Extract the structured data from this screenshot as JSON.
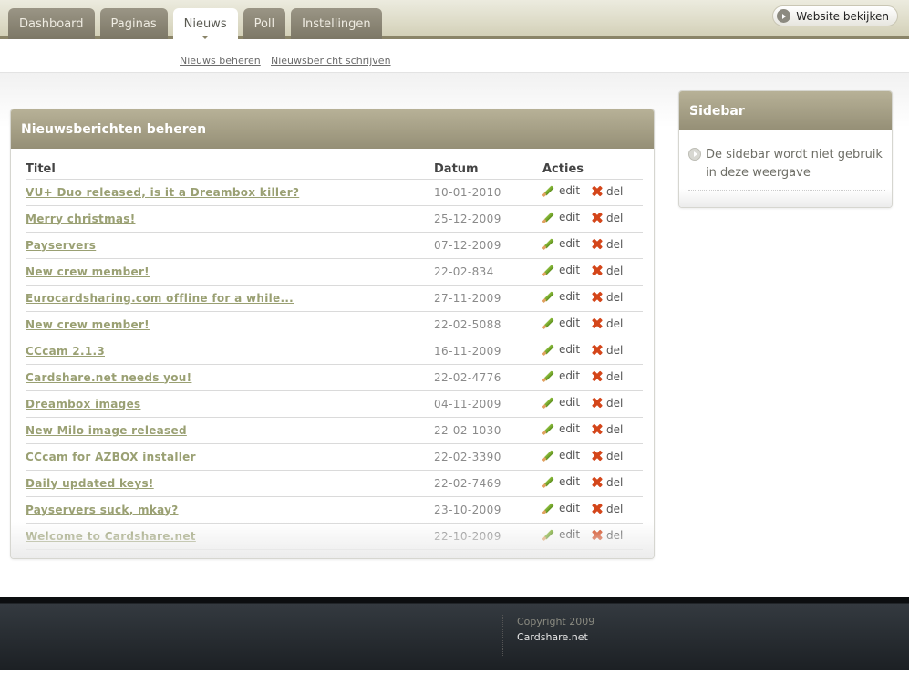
{
  "nav": {
    "tabs": [
      {
        "label": "Dashboard"
      },
      {
        "label": "Paginas"
      },
      {
        "label": "Nieuws",
        "active": true
      },
      {
        "label": "Poll"
      },
      {
        "label": "Instellingen"
      }
    ],
    "view_site_label": "Website bekijken"
  },
  "subnav": {
    "items": [
      {
        "label": "Nieuws beheren"
      },
      {
        "label": "Nieuwsbericht schrijven"
      }
    ]
  },
  "panel": {
    "title": "Nieuwsberichten beheren",
    "columns": [
      "Titel",
      "Datum",
      "Acties"
    ],
    "edit_label": "edit",
    "del_label": "del",
    "rows": [
      {
        "title": "VU+ Duo released, is it a Dreambox killer?",
        "date": "10-01-2010"
      },
      {
        "title": "Merry christmas!",
        "date": "25-12-2009"
      },
      {
        "title": "Payservers",
        "date": "07-12-2009"
      },
      {
        "title": "New crew member!",
        "date": "22-02-834"
      },
      {
        "title": "Eurocardsharing.com offline for a while...",
        "date": "27-11-2009"
      },
      {
        "title": "New crew member!",
        "date": "22-02-5088"
      },
      {
        "title": "CCcam 2.1.3",
        "date": "16-11-2009"
      },
      {
        "title": "Cardshare.net needs you!",
        "date": "22-02-4776"
      },
      {
        "title": "Dreambox images",
        "date": "04-11-2009"
      },
      {
        "title": "New Milo image released",
        "date": "22-02-1030"
      },
      {
        "title": "CCcam for AZBOX installer",
        "date": "22-02-3390"
      },
      {
        "title": "Daily updated keys!",
        "date": "22-02-7469"
      },
      {
        "title": "Payservers suck, mkay?",
        "date": "23-10-2009"
      },
      {
        "title": "Welcome to Cardshare.net",
        "date": "22-10-2009"
      }
    ]
  },
  "sidebar": {
    "title": "Sidebar",
    "text": "De sidebar wordt niet gebruik in deze weergave"
  },
  "footer": {
    "copyright": "Copyright 2009",
    "site": "Cardshare.net"
  },
  "colors": {
    "accent_olive": "#a39d82",
    "link_green": "#9aa073",
    "delete_red": "#d4461a"
  }
}
